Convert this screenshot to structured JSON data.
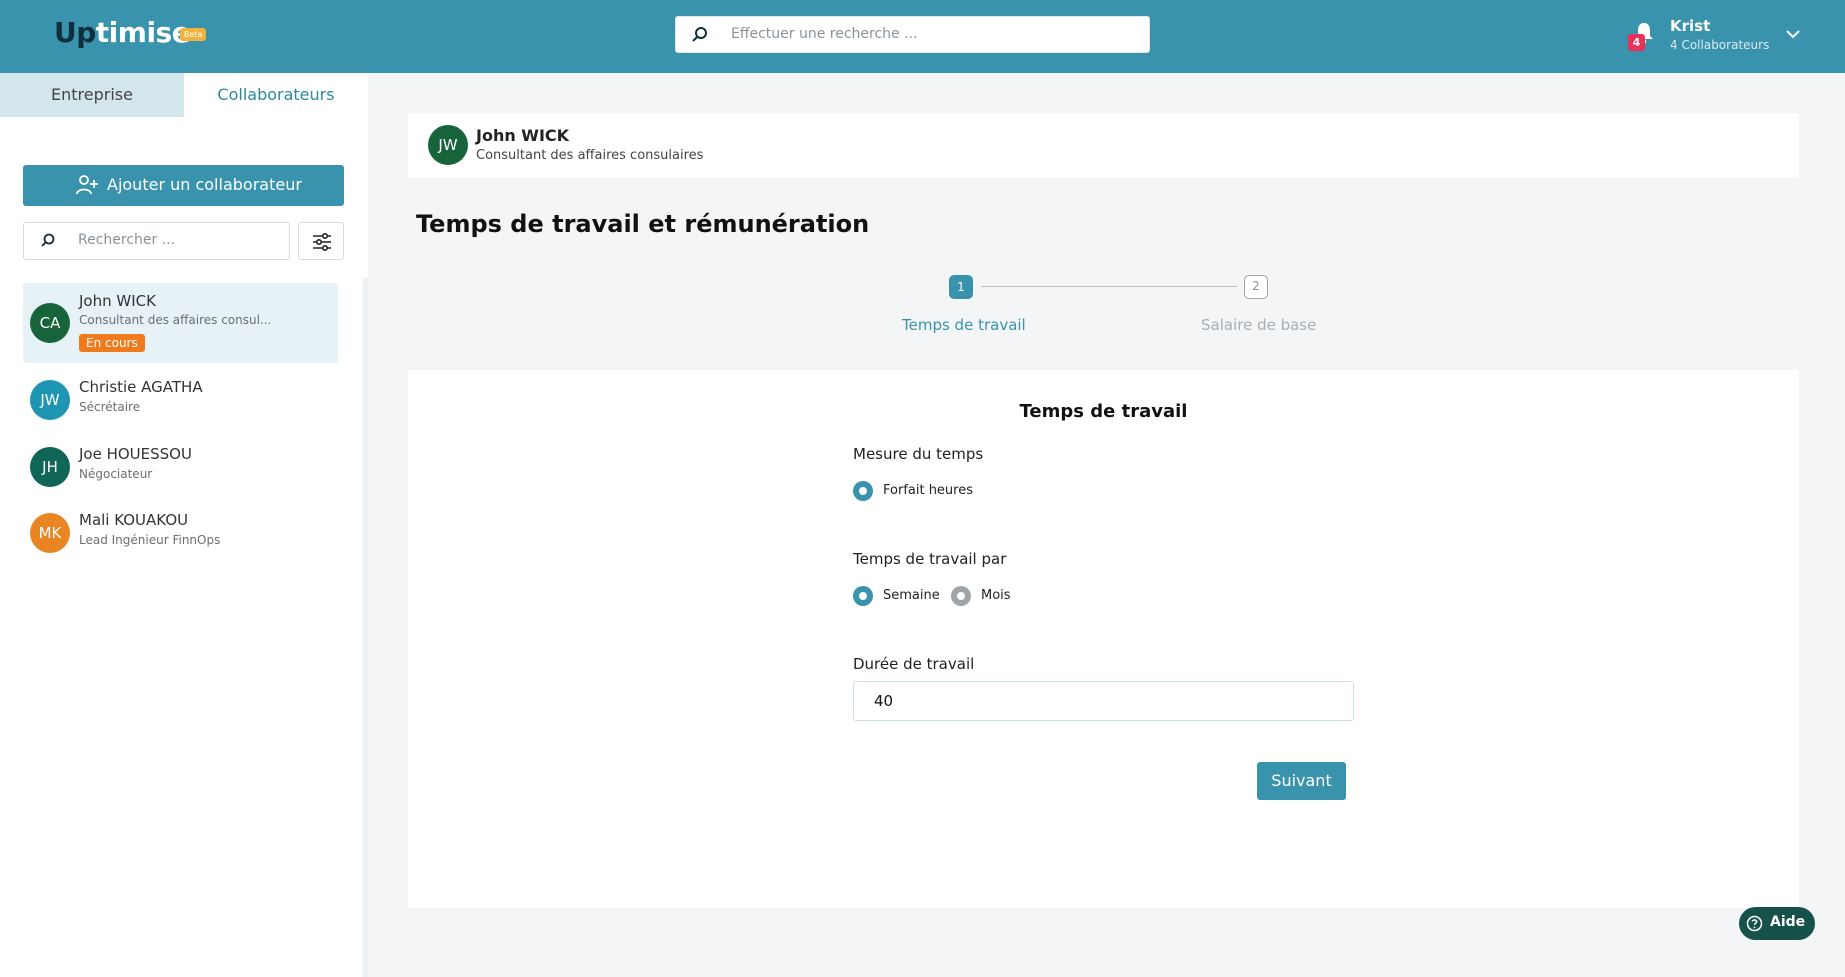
{
  "app": {
    "name_part1": "Up",
    "name_part2": "timise",
    "badge": "Beta"
  },
  "header": {
    "search_placeholder": "Effectuer une recherche ...",
    "notifications_count": "4",
    "user_name": "Krist",
    "user_sub": "4 Collaborateurs"
  },
  "sidebar": {
    "tabs": [
      "Entreprise",
      "Collaborateurs"
    ],
    "add_button": "Ajouter un collaborateur",
    "search_placeholder": "Rechercher ...",
    "employees": [
      {
        "initials": "CA",
        "name": "John WICK",
        "role": "Consultant des affaires consul...",
        "status": "En cours",
        "color": "#17643a"
      },
      {
        "initials": "JW",
        "name": "Christie AGATHA",
        "role": "Sécrétaire",
        "color": "#1e95b3"
      },
      {
        "initials": "JH",
        "name": "Joe HOUESSOU",
        "role": "Négociateur",
        "color": "#0f6657"
      },
      {
        "initials": "MK",
        "name": "Mali KOUAKOU",
        "role": "Lead Ingénieur FinnOps",
        "color": "#ea8523"
      }
    ]
  },
  "profile": {
    "initials": "JW",
    "name": "John WICK",
    "role": "Consultant des affaires consulaires"
  },
  "page_title": "Temps de travail et rémunération",
  "stepper": {
    "steps": [
      {
        "number": "1",
        "label": "Temps de travail"
      },
      {
        "number": "2",
        "label": "Salaire de base"
      }
    ]
  },
  "form": {
    "title": "Temps de travail",
    "mesure_label": "Mesure du temps",
    "mesure_option": "Forfait heures",
    "par_label": "Temps de travail par",
    "par_options": [
      "Semaine",
      "Mois"
    ],
    "duree_label": "Durée de travail",
    "duree_value": "40",
    "next_button": "Suivant"
  },
  "help_button": "Aide",
  "colors": {
    "primary": "#3a93ac",
    "status_orange": "#f07b1e",
    "badge_red": "#e7325a",
    "help_green": "#16524a"
  }
}
